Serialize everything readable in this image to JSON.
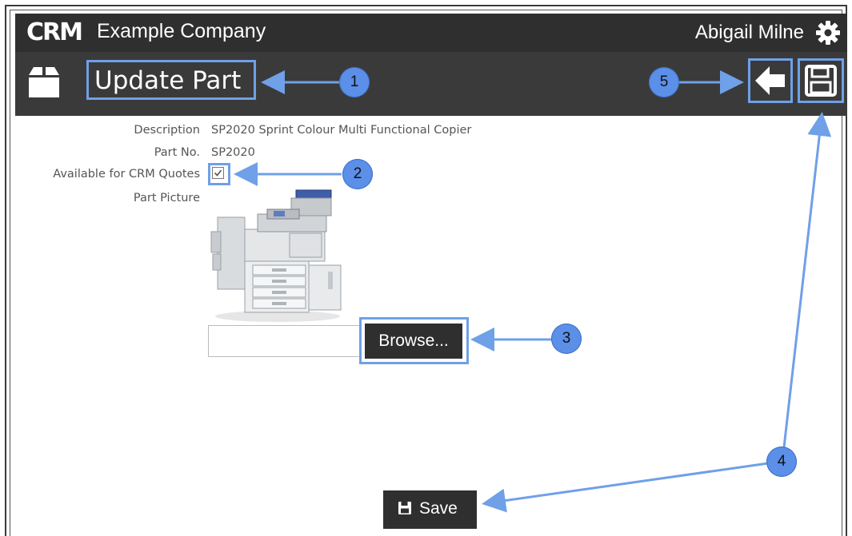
{
  "header": {
    "logo_text": "CRM",
    "company_name": "Example Company",
    "user_name": "Abigail Milne",
    "settings_icon": "gear-icon"
  },
  "toolbar": {
    "page_icon": "box-icon",
    "title": "Update Part",
    "back_icon": "arrow-left-icon",
    "save_icon": "floppy-disk-icon"
  },
  "form": {
    "description_label": "Description",
    "description_value": "SP2020 Sprint Colour Multi Functional Copier",
    "part_no_label": "Part No.",
    "part_no_value": "SP2020",
    "crm_quotes_label": "Available for CRM Quotes",
    "crm_quotes_checked": true,
    "picture_label": "Part Picture",
    "file_input_value": "",
    "browse_label": "Browse..."
  },
  "footer": {
    "save_label": "Save"
  },
  "callouts": [
    "1",
    "2",
    "3",
    "4",
    "5"
  ],
  "colors": {
    "bar_dark": "#2f2f2f",
    "bar_mid": "#3a3a3a",
    "highlight": "#6fa0e8",
    "callout_fill": "#5b8fe8"
  }
}
